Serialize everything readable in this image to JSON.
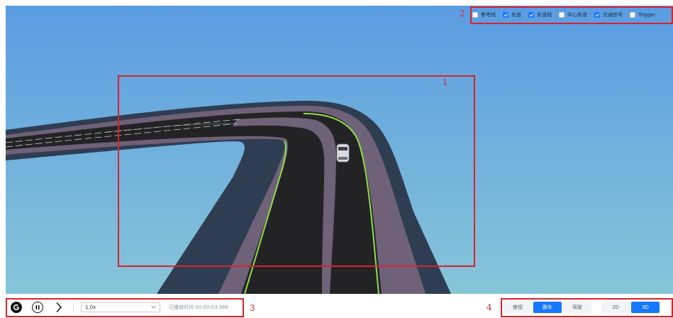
{
  "overlay_toggles": [
    {
      "label": "参考线",
      "checked": false
    },
    {
      "label": "车道",
      "checked": true
    },
    {
      "label": "车道线",
      "checked": true
    },
    {
      "label": "中心车道",
      "checked": false
    },
    {
      "label": "交通信号",
      "checked": true
    },
    {
      "label": "Trigger",
      "checked": false
    }
  ],
  "playback": {
    "speed": "1.0x",
    "elapsed_label": "已播放时间",
    "elapsed_time": "00:00:03.966"
  },
  "view_modes": {
    "camera": [
      {
        "label": "俯视",
        "active": false
      },
      {
        "label": "跟车",
        "active": true
      },
      {
        "label": "驾驶",
        "active": false
      }
    ],
    "dimension": [
      {
        "label": "2D",
        "active": false
      },
      {
        "label": "3D",
        "active": true
      }
    ]
  },
  "annotations": [
    "1",
    "2",
    "3",
    "4"
  ],
  "colors": {
    "accent": "#1677ff",
    "annotation": "#d9232a",
    "sky_top": "#5b9ee0",
    "sky_bottom": "#86c4da",
    "asphalt": "#232325",
    "curb": "#6e6178",
    "shoulder": "#2f3d52",
    "lane_edge": "#8ee04a"
  }
}
